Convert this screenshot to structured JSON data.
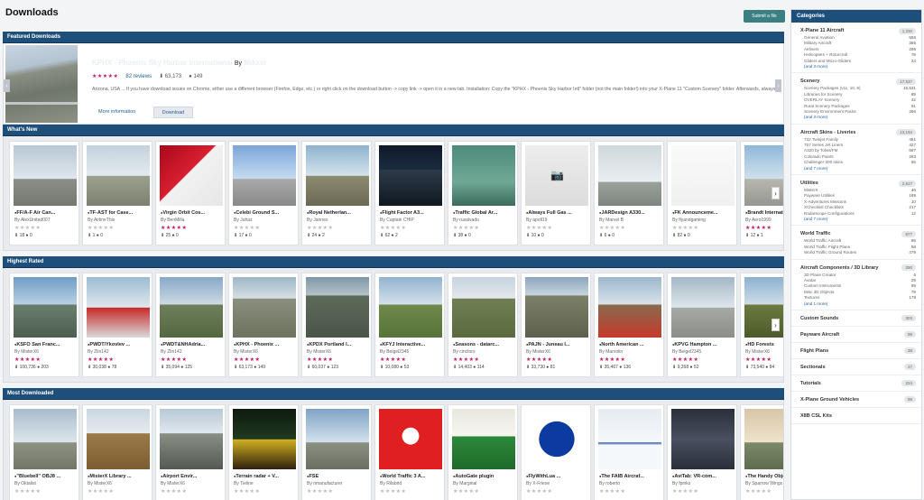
{
  "page": {
    "title": "Downloads",
    "submit_label": "Submit a file"
  },
  "featured": {
    "section_label": "Featured Downloads",
    "title": "KPHX - Phoenix Sky Harbor International",
    "by_label": "By",
    "author": "Mikxer",
    "rating_stars": 5,
    "reviews": "82 reviews",
    "downloads": "63,173",
    "comments": "149",
    "description": "Arizona, USA  ...  If you have download issues on Chrome, either use a different browser (Firefox, Edge, etc.) or right click on the download button -> copy link -> open it in a new tab. Installation:  Copy the \"KPHX - Phoenix Sky Harbor Intl\" folder (not the main folder!) into your X-Plane 11 \"Custom Scenery\" folder. Afterwards, always make sure that this scenery package has higher priority in your scenery_packs.ini than \"Global Airports\" ...",
    "more_label": "More information",
    "download_label": "Download"
  },
  "whats_new": {
    "label": "What's New",
    "items": [
      {
        "title": "FF/A-F Air Can...",
        "by": "By AlexUnited007",
        "stars": 0,
        "downloads": "18",
        "comments": "0"
      },
      {
        "title": "TF-AST for Case...",
        "by": "By AirlineThis",
        "stars": 0,
        "downloads": "1",
        "comments": "0"
      },
      {
        "title": "Virgin Orbit Cos...",
        "by": "By BenMilla",
        "stars": 5,
        "downloads": "25",
        "comments": "0"
      },
      {
        "title": "Celebi Ground S...",
        "by": "By Juhaz",
        "stars": 0,
        "downloads": "17",
        "comments": "0"
      },
      {
        "title": "Royal Netherlan...",
        "by": "By Jannes",
        "stars": 0,
        "downloads": "24",
        "comments": "2"
      },
      {
        "title": "Flight Factor A3...",
        "by": "By Captain CHIP",
        "stars": 0,
        "downloads": "62",
        "comments": "2"
      },
      {
        "title": "Traffic Global Ar...",
        "by": "By rusalvado",
        "stars": 0,
        "downloads": "38",
        "comments": "0"
      },
      {
        "title": "Always Full Gas ...",
        "by": "By apoll19",
        "stars": 0,
        "downloads": "10",
        "comments": "0"
      },
      {
        "title": "JARDesign A330...",
        "by": "By Marvel B",
        "stars": 0,
        "downloads": "6",
        "comments": "0"
      },
      {
        "title": "FK Announceme...",
        "by": "By flyandgaming",
        "stars": 0,
        "downloads": "82",
        "comments": "0"
      },
      {
        "title": "Brandt Internatio...",
        "by": "By Aero1999",
        "stars": 5,
        "downloads": "12",
        "comments": "1"
      }
    ]
  },
  "highest_rated": {
    "label": "Highest Rated",
    "items": [
      {
        "title": "KSFO San Franc...",
        "by": "By MisterX6",
        "stars": 5,
        "downloads": "100,736",
        "comments": "203"
      },
      {
        "title": "PWDT/Ykovlev ...",
        "by": "By Zlin142",
        "stars": 5,
        "downloads": "30,038",
        "comments": "78"
      },
      {
        "title": "PWDT&NHAdria...",
        "by": "By Zlin142",
        "stars": 5,
        "downloads": "35,094",
        "comments": "125"
      },
      {
        "title": "KPHX - Phoenix ...",
        "by": "By MisterX6",
        "stars": 5,
        "downloads": "63,173",
        "comments": "149"
      },
      {
        "title": "KPDX Portland I...",
        "by": "By MisterX6",
        "stars": 5,
        "downloads": "60,037",
        "comments": "123"
      },
      {
        "title": "KFYJ Interactive...",
        "by": "By Beigel2345",
        "stars": 5,
        "downloads": "10,080",
        "comments": "53"
      },
      {
        "title": "Seasons - datarc...",
        "by": "By cinctors",
        "stars": 5,
        "downloads": "14,403",
        "comments": "114"
      },
      {
        "title": "PAJN - Juneau I...",
        "by": "By MisterX6",
        "stars": 5,
        "downloads": "33,730",
        "comments": "81"
      },
      {
        "title": "North American ...",
        "by": "By Marvolin",
        "stars": 5,
        "downloads": "35,467",
        "comments": "136"
      },
      {
        "title": "KPVG Hampton ...",
        "by": "By Beigel2345",
        "stars": 5,
        "downloads": "9,268",
        "comments": "52"
      },
      {
        "title": "HD Forests",
        "by": "By MisterX6",
        "stars": 5,
        "downloads": "73,540",
        "comments": "84"
      }
    ]
  },
  "most_downloaded": {
    "label": "Most Downloaded",
    "items": [
      {
        "title": "\"Bluebell\" OBJ8 ...",
        "by": "By Oktalist",
        "stars": 0,
        "downloads": "",
        "comments": ""
      },
      {
        "title": "MisterX Library ...",
        "by": "By MisterX6",
        "stars": 0,
        "downloads": "",
        "comments": ""
      },
      {
        "title": "Airport Envir...",
        "by": "By MisterX6",
        "stars": 0,
        "downloads": "",
        "comments": ""
      },
      {
        "title": "Terrain radar + V...",
        "by": "By Tieline",
        "stars": 0,
        "downloads": "",
        "comments": ""
      },
      {
        "title": "FSE",
        "by": "By nmanufacturer",
        "stars": 0,
        "downloads": "",
        "comments": ""
      },
      {
        "title": "World Traffic 3 A...",
        "by": "By Rilabrid",
        "stars": 0,
        "downloads": "",
        "comments": ""
      },
      {
        "title": "AutoGate plugin",
        "by": "By Marginal",
        "stars": 0,
        "downloads": "",
        "comments": ""
      },
      {
        "title": "FlyWithLua ...",
        "by": "By X-Friese",
        "stars": 0,
        "downloads": "",
        "comments": ""
      },
      {
        "title": "The FAIB Aircraf...",
        "by": "By roberto",
        "stars": 0,
        "downloads": "",
        "comments": ""
      },
      {
        "title": "AviTab: VR-com...",
        "by": "By fpinks",
        "stars": 0,
        "downloads": "",
        "comments": ""
      },
      {
        "title": "The Handy Obje...",
        "by": "By Sparrow Wings",
        "stars": 0,
        "downloads": "",
        "comments": ""
      }
    ]
  },
  "sidebar": {
    "title": "Categories",
    "categories": [
      {
        "name": "X-Plane 11 Aircraft",
        "count": "1,330",
        "subs": [
          {
            "name": "General Aviation",
            "n": "556"
          },
          {
            "name": "Military Aircraft",
            "n": "365"
          },
          {
            "name": "Airliners",
            "n": "296"
          },
          {
            "name": "Helicopters + Rotorcraft",
            "n": "76"
          },
          {
            "name": "Gliders and Micro-Gliders",
            "n": "24"
          }
        ],
        "more": "(and 3 more)"
      },
      {
        "name": "Scenery",
        "count": "17,537",
        "subs": [
          {
            "name": "Scenery Packages (v11, 10, 9)",
            "n": "16,531"
          },
          {
            "name": "Libraries for Scenery",
            "n": "89"
          },
          {
            "name": "OVERLAY Scenery",
            "n": "42"
          },
          {
            "name": "Rural Scenery Packages",
            "n": "91"
          },
          {
            "name": "Scenery Environment Packs",
            "n": "266"
          }
        ],
        "more": "(and 3 more)"
      },
      {
        "name": "Aircraft Skins - Liveries",
        "count": "13,194",
        "subs": [
          {
            "name": "732 Twinjet Family",
            "n": "481"
          },
          {
            "name": "757 Series Jet Liners",
            "n": "427"
          },
          {
            "name": "A320 by Toliss/FM",
            "n": "667"
          },
          {
            "name": "Colorado Paints",
            "n": "263"
          },
          {
            "name": "Challenger 300 skins",
            "n": "65"
          }
        ],
        "more": "(and 7 more)"
      },
      {
        "name": "Utilities",
        "count": "2,517",
        "subs": [
          {
            "name": "MisterX",
            "n": "46"
          },
          {
            "name": "Payware Utilities",
            "n": "189"
          },
          {
            "name": "X-Adventures Missions",
            "n": "10"
          },
          {
            "name": "XChecklist Checklists",
            "n": "217"
          },
          {
            "name": "Radarscope Configurations",
            "n": "12"
          }
        ],
        "more": "(and 7 more)"
      },
      {
        "name": "World Traffic",
        "count": "877",
        "subs": [
          {
            "name": "World Traffic Aircraft",
            "n": "86"
          },
          {
            "name": "World Traffic Flight Plans",
            "n": "58"
          },
          {
            "name": "World Traffic Ground Routes",
            "n": "479"
          }
        ],
        "more": ""
      },
      {
        "name": "Aircraft Components / 3D Library",
        "count": "290",
        "subs": [
          {
            "name": "3D Plane Creator",
            "n": "6"
          },
          {
            "name": "Avatar",
            "n": "29"
          },
          {
            "name": "Custom Instruments",
            "n": "59"
          },
          {
            "name": "Misc 3D Objects",
            "n": "79"
          },
          {
            "name": "Textures",
            "n": "179"
          }
        ],
        "more": "(and 1 more)"
      },
      {
        "name": "Custom Sounds",
        "count": "303",
        "subs": [],
        "more": ""
      },
      {
        "name": "Payware Aircraft",
        "count": "99",
        "subs": [],
        "more": ""
      },
      {
        "name": "Flight Plans",
        "count": "38",
        "subs": [],
        "more": ""
      },
      {
        "name": "Sectionals",
        "count": "27",
        "subs": [],
        "more": ""
      },
      {
        "name": "Tutorials",
        "count": "224",
        "subs": [],
        "more": ""
      },
      {
        "name": "X-Plane Ground Vehicles",
        "count": "98",
        "subs": [],
        "more": ""
      },
      {
        "name": "X8B CSL Kits",
        "count": "",
        "subs": [],
        "more": ""
      }
    ]
  },
  "colors": {
    "header_bar": "#1d4f7a",
    "star": "#c2185b",
    "submit": "#3b7f83"
  }
}
